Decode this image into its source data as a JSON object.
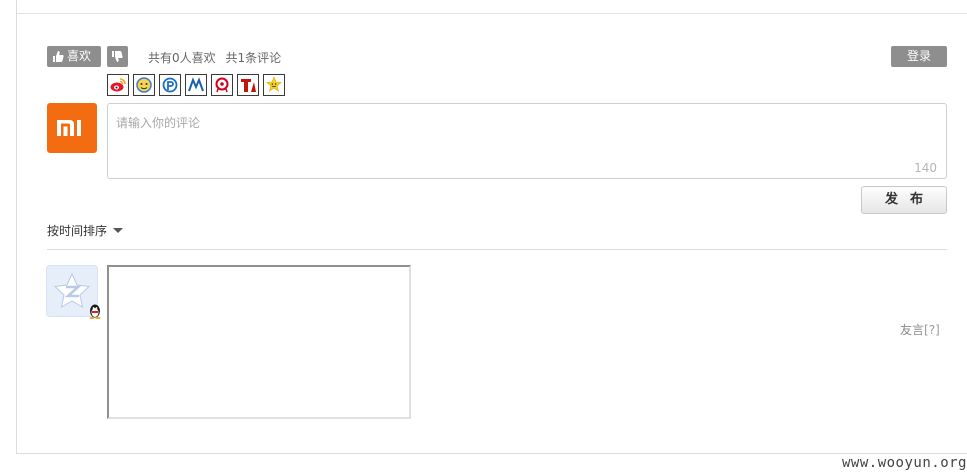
{
  "toolbar": {
    "like_label": "喜欢",
    "like_stats": "共有0人喜欢",
    "comment_stats": "共1条评论",
    "login_label": "登录"
  },
  "share_icons": [
    "sina-weibo-icon",
    "qzone-icon",
    "pengyou-icon",
    "renren-icon",
    "netease-icon",
    "tianya-icon",
    "smiley-icon"
  ],
  "brand": {
    "logo_text": "mi",
    "color": "#f46c11"
  },
  "comment": {
    "placeholder": "请输入你的评论",
    "char_count": "140",
    "publish_label": "发布"
  },
  "sort": {
    "label": "按时间排序"
  },
  "speak": {
    "label": "友言",
    "help": "[?]"
  },
  "watermark": "www.wooyun.org",
  "colors": {
    "button_gray": "#8e8e8e",
    "accent_orange": "#f46c11"
  }
}
